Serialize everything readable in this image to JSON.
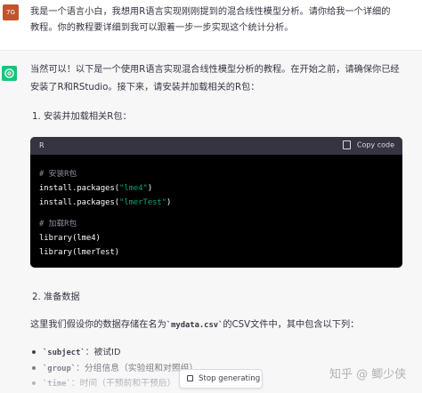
{
  "user_message": {
    "avatar_text": "7G",
    "line1": "我是一个语言小白，我想用R语言实现刚刚提到的混合线性模型分析。请你给我一个详细的",
    "line2": "教程。你的教程要详细到我可以跟着一步一步实现这个统计分析。"
  },
  "assistant": {
    "intro_line1": "当然可以！以下是一个使用R语言实现混合线性模型分析的教程。在开始之前，请确保你已经",
    "intro_line2": "安装了R和RStudio。接下来，请安装并加载相关的R包：",
    "step1": "1. 安装并加载相关R包：",
    "code": {
      "language": "R",
      "copy_label": "Copy code",
      "comment1": "# 安装R包",
      "line1_prefix": "install.packages(",
      "line1_str": "\"lme4\"",
      "line1_suffix": ")",
      "line2_prefix": "install.packages(",
      "line2_str": "\"lmerTest\"",
      "line2_suffix": ")",
      "comment2": "# 加载R包",
      "line3": "library(lme4)",
      "line4": "library(lmerTest)"
    },
    "step2": "2. 准备数据",
    "data_intro_prefix": "这里我们假设你的数据存储在名为",
    "data_intro_file": "`mydata.csv`",
    "data_intro_suffix": "的CSV文件中，其中包含以下列：",
    "bullets": [
      {
        "code": "`subject`",
        "text": "：被试ID"
      },
      {
        "code": "`group`",
        "text": "：分组信息（实验组和对照组）"
      },
      {
        "code": "`time`",
        "text": "：时间（干预前和干预后）"
      }
    ]
  },
  "stop_button": {
    "label": "Stop generating"
  },
  "watermark": "知乎 @ 鲫少侠"
}
